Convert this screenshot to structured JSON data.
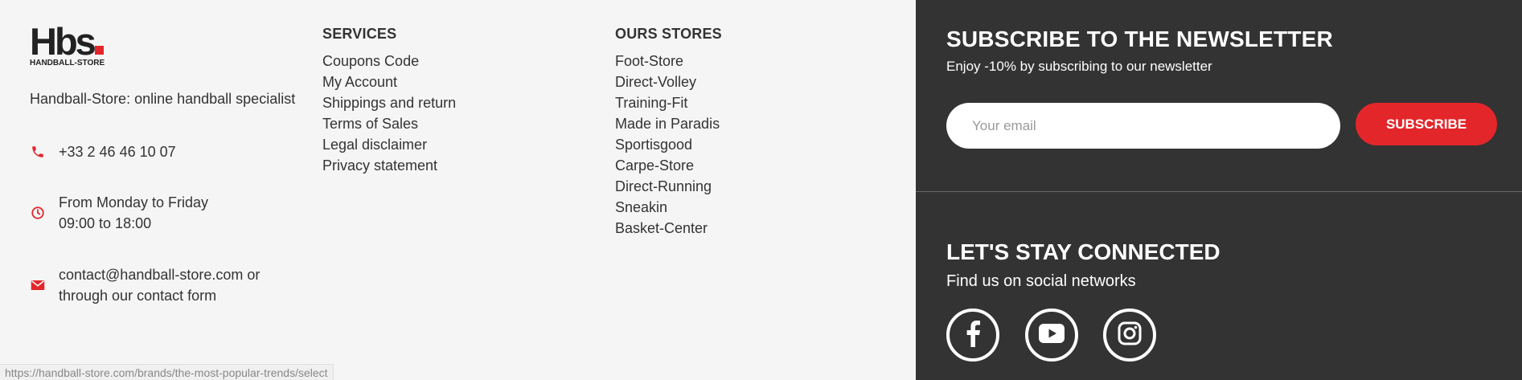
{
  "brand": {
    "logo_main": "Hbs",
    "logo_sub": "HANDBALL-STORE",
    "tagline": "Handball-Store: online handball specialist"
  },
  "contact": {
    "phone": "+33 2 46 46 10 07",
    "hours_line1": "From Monday to Friday",
    "hours_line2": "09:00 to 18:00",
    "email_line1": "contact@handball-store.com or",
    "email_line2": "through our contact form",
    "icon_color": "#e3262a"
  },
  "services": {
    "title": "SERVICES",
    "items": [
      "Coupons Code",
      "My Account",
      "Shippings and return",
      "Terms of Sales",
      "Legal disclaimer",
      "Privacy statement"
    ]
  },
  "stores": {
    "title": "OURS STORES",
    "items": [
      "Foot-Store",
      "Direct-Volley",
      "Training-Fit",
      "Made in Paradis",
      "Sportisgood",
      "Carpe-Store",
      "Direct-Running",
      "Sneakin",
      "Basket-Center"
    ]
  },
  "newsletter": {
    "title": "SUBSCRIBE TO THE NEWSLETTER",
    "subtitle": "Enjoy -10% by subscribing to our newsletter",
    "email_placeholder": "Your email",
    "button_label": "SUBSCRIBE",
    "accent": "#e3262a"
  },
  "social": {
    "title": "LET'S STAY CONNECTED",
    "subtitle": "Find us on social networks",
    "networks": [
      "facebook-icon",
      "youtube-icon",
      "instagram-icon"
    ]
  },
  "status_bar": {
    "url": "https://handball-store.com/brands/the-most-popular-trends/select"
  }
}
